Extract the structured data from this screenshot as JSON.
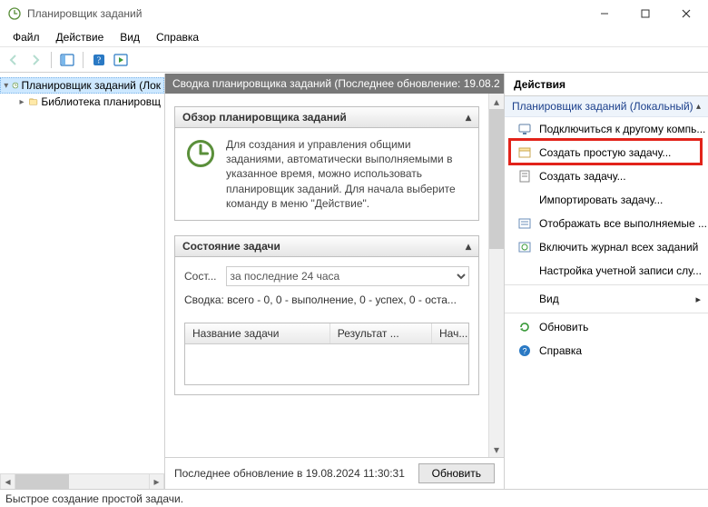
{
  "window": {
    "title": "Планировщик заданий"
  },
  "menu": {
    "file": "Файл",
    "action": "Действие",
    "view": "Вид",
    "help": "Справка"
  },
  "tree": {
    "root": "Планировщик заданий (Лок",
    "child": "Библиотека планировщ"
  },
  "center": {
    "header": "Сводка планировщика заданий (Последнее обновление: 19.08.2",
    "overview_title": "Обзор планировщика заданий",
    "overview_text": "Для создания и управления общими заданиями, автоматически выполняемыми в указанное время, можно использовать планировщик заданий. Для начала выберите команду в меню \"Действие\".",
    "state_title": "Состояние задачи",
    "state_label": "Сост...",
    "state_select": "за последние 24 часа",
    "summary": "Сводка: всего - 0, 0 - выполнение, 0 - успех, 0 - оста...",
    "col_name": "Название задачи",
    "col_result": "Результат ...",
    "col_start": "Нач...",
    "update_label": "Последнее обновление в 19.08.2024 11:30:31",
    "update_btn": "Обновить"
  },
  "actions": {
    "title": "Действия",
    "group": "Планировщик заданий (Локальный)",
    "items": {
      "connect": "Подключиться к другому компь...",
      "create_basic": "Создать простую задачу...",
      "create": "Создать задачу...",
      "import": "Импортировать задачу...",
      "show_running": "Отображать все выполняемые ...",
      "enable_history": "Включить журнал всех заданий",
      "account_config": "Настройка учетной записи слу...",
      "view": "Вид",
      "refresh": "Обновить",
      "help": "Справка"
    }
  },
  "statusbar": "Быстрое создание простой задачи."
}
